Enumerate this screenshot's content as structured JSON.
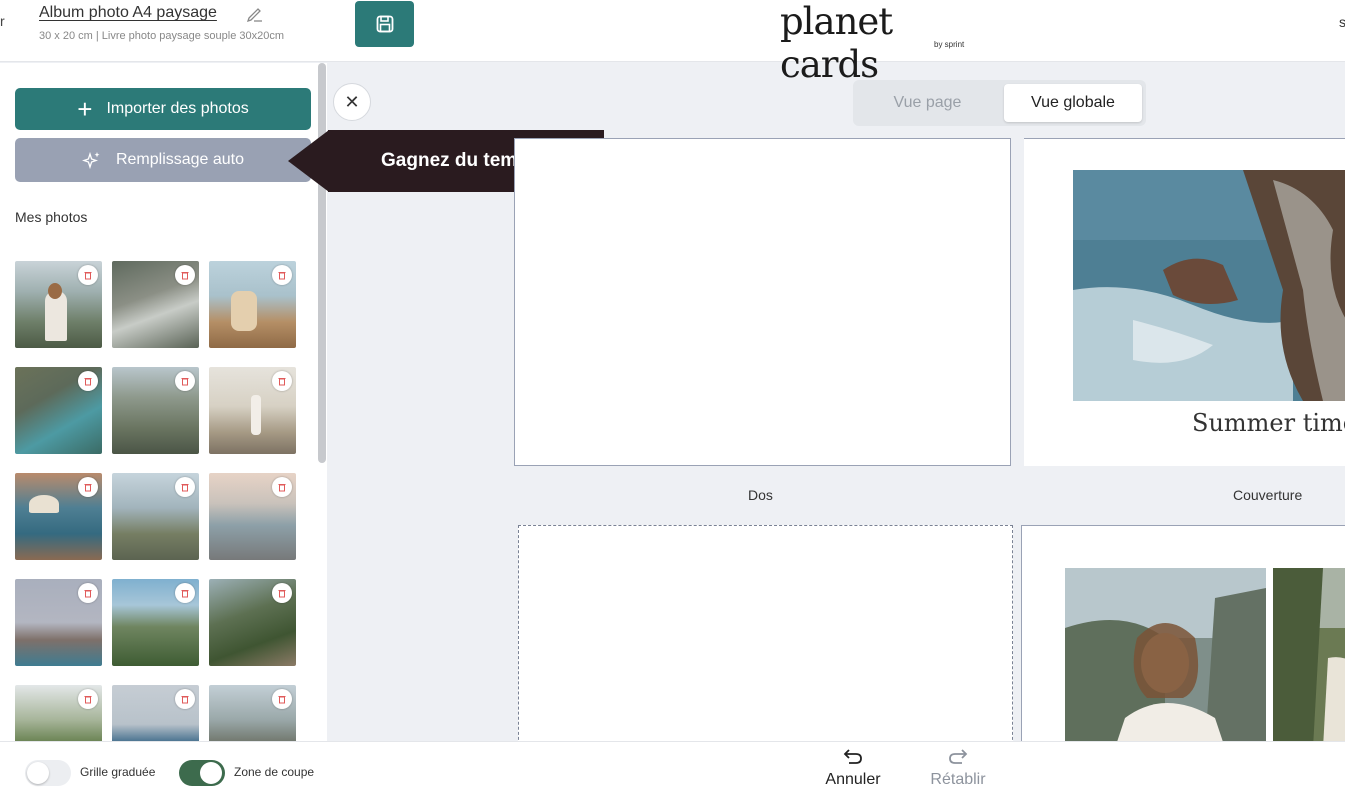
{
  "header": {
    "back_edge_text": "r",
    "album_title": "Album photo A4 paysage",
    "album_subtitle": "30 x 20 cm | Livre photo paysage souple 30x20cm",
    "brand_name": "planet cards",
    "brand_by": "by sprint",
    "right_edge_text": "s"
  },
  "sidebar": {
    "import_label": "Importer des photos",
    "autofill_label": "Remplissage auto",
    "section_title": "Mes photos"
  },
  "tooltip": {
    "text": "Gagnez du temps !"
  },
  "view_toggle": {
    "page": "Vue page",
    "global": "Vue globale",
    "selected": "Vue globale"
  },
  "pages": {
    "back_label": "Dos",
    "cover_label": "Couverture",
    "cover_text": "Summer time"
  },
  "footer": {
    "ruler_grid_label": "Grille graduée",
    "ruler_grid_on": false,
    "crop_zone_label": "Zone de coupe",
    "crop_zone_on": true,
    "undo_label": "Annuler",
    "redo_label": "Rétablir"
  },
  "icons": {
    "edit": "pencil-icon",
    "save": "floppy-icon",
    "import": "plus-icon",
    "autofill": "sparkles-icon",
    "trash": "trash-icon",
    "close": "close-icon",
    "undo": "undo-icon",
    "redo": "redo-icon"
  },
  "colors": {
    "primary": "#2c7a78",
    "autofill": "#99a1b3",
    "tooltip": "#2a1b1f",
    "toggle_on": "#3d6b4d",
    "trash": "#e05a5a"
  }
}
